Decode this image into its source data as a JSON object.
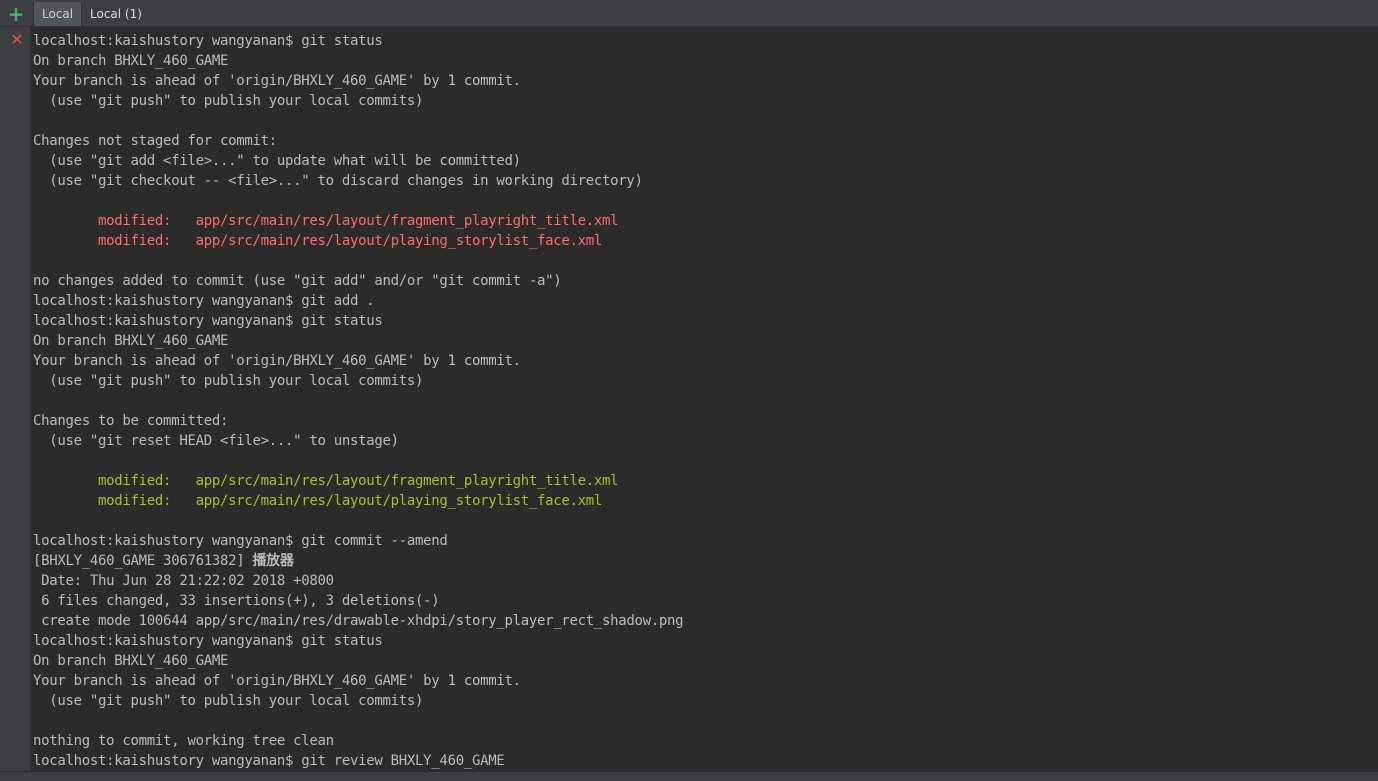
{
  "tabs": {
    "add_icon": "plus-icon",
    "items": [
      {
        "label": "Local"
      },
      {
        "label": "Local (1)"
      }
    ]
  },
  "gutter": {
    "close_icon": "close-icon"
  },
  "colors": {
    "background": "#2b2b2b",
    "text": "#bbbbbb",
    "modified_unstaged": "#ff6b68",
    "modified_staged": "#a8c023",
    "add_icon": "#59a869",
    "close_icon": "#e0503c"
  },
  "terminal": {
    "lines": [
      {
        "text": "localhost:kaishustory wangyanan$ git status",
        "style": "normal"
      },
      {
        "text": "On branch BHXLY_460_GAME",
        "style": "normal"
      },
      {
        "text": "Your branch is ahead of 'origin/BHXLY_460_GAME' by 1 commit.",
        "style": "normal"
      },
      {
        "text": "  (use \"git push\" to publish your local commits)",
        "style": "normal"
      },
      {
        "text": "",
        "style": "normal"
      },
      {
        "text": "Changes not staged for commit:",
        "style": "normal"
      },
      {
        "text": "  (use \"git add <file>...\" to update what will be committed)",
        "style": "normal"
      },
      {
        "text": "  (use \"git checkout -- <file>...\" to discard changes in working directory)",
        "style": "normal"
      },
      {
        "text": "",
        "style": "normal"
      },
      {
        "text": "        modified:   app/src/main/res/layout/fragment_playright_title.xml",
        "style": "red"
      },
      {
        "text": "        modified:   app/src/main/res/layout/playing_storylist_face.xml",
        "style": "red"
      },
      {
        "text": "",
        "style": "normal"
      },
      {
        "text": "no changes added to commit (use \"git add\" and/or \"git commit -a\")",
        "style": "normal"
      },
      {
        "text": "localhost:kaishustory wangyanan$ git add .",
        "style": "normal"
      },
      {
        "text": "localhost:kaishustory wangyanan$ git status",
        "style": "normal"
      },
      {
        "text": "On branch BHXLY_460_GAME",
        "style": "normal"
      },
      {
        "text": "Your branch is ahead of 'origin/BHXLY_460_GAME' by 1 commit.",
        "style": "normal"
      },
      {
        "text": "  (use \"git push\" to publish your local commits)",
        "style": "normal"
      },
      {
        "text": "",
        "style": "normal"
      },
      {
        "text": "Changes to be committed:",
        "style": "normal"
      },
      {
        "text": "  (use \"git reset HEAD <file>...\" to unstage)",
        "style": "normal"
      },
      {
        "text": "",
        "style": "normal"
      },
      {
        "text": "        modified:   app/src/main/res/layout/fragment_playright_title.xml",
        "style": "green"
      },
      {
        "text": "        modified:   app/src/main/res/layout/playing_storylist_face.xml",
        "style": "green"
      },
      {
        "text": "",
        "style": "normal"
      },
      {
        "text": "localhost:kaishustory wangyanan$ git commit --amend",
        "style": "normal"
      },
      {
        "text": "[BHXLY_460_GAME 306761382] ",
        "style": "normal",
        "cjk": "播放器"
      },
      {
        "text": " Date: Thu Jun 28 21:22:02 2018 +0800",
        "style": "normal"
      },
      {
        "text": " 6 files changed, 33 insertions(+), 3 deletions(-)",
        "style": "normal"
      },
      {
        "text": " create mode 100644 app/src/main/res/drawable-xhdpi/story_player_rect_shadow.png",
        "style": "normal"
      },
      {
        "text": "localhost:kaishustory wangyanan$ git status",
        "style": "normal"
      },
      {
        "text": "On branch BHXLY_460_GAME",
        "style": "normal"
      },
      {
        "text": "Your branch is ahead of 'origin/BHXLY_460_GAME' by 1 commit.",
        "style": "normal"
      },
      {
        "text": "  (use \"git push\" to publish your local commits)",
        "style": "normal"
      },
      {
        "text": "",
        "style": "normal"
      },
      {
        "text": "nothing to commit, working tree clean",
        "style": "normal"
      },
      {
        "text": "localhost:kaishustory wangyanan$ git review BHXLY_460_GAME",
        "style": "normal"
      }
    ]
  }
}
